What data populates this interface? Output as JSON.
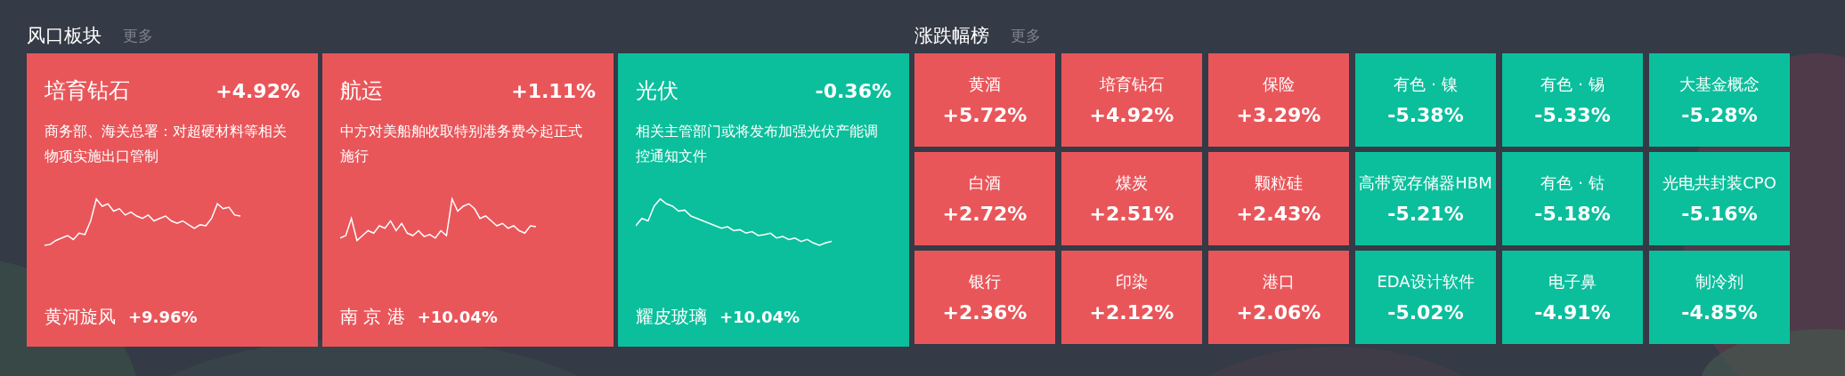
{
  "hot_sectors": {
    "title": "风口板块",
    "more": "更多",
    "cards": [
      {
        "name": "培育钻石",
        "change": "+4.92%",
        "color": "#e9565a",
        "news": "商务部、海关总署：对超硬材料等相关物项实施出口管制",
        "lead_stock": "黄河旋风",
        "lead_change": "+9.96%"
      },
      {
        "name": "航运",
        "change": "+1.11%",
        "color": "#e9565a",
        "news": "中方对美船舶收取特别港务费今起正式施行",
        "lead_stock": "南 京 港",
        "lead_change": "+10.04%"
      },
      {
        "name": "光伏",
        "change": "-0.36%",
        "color": "#0bbf9c",
        "news": "相关主管部门或将发布加强光伏产能调控通知文件",
        "lead_stock": "耀皮玻璃",
        "lead_change": "+10.04%"
      }
    ]
  },
  "ranking": {
    "title": "涨跌幅榜",
    "more": "更多",
    "tiles": [
      {
        "name": "黄酒",
        "change": "+5.72%",
        "color": "#e9565a"
      },
      {
        "name": "培育钻石",
        "change": "+4.92%",
        "color": "#e9565a"
      },
      {
        "name": "保险",
        "change": "+3.29%",
        "color": "#e9565a"
      },
      {
        "name": "有色 · 镍",
        "change": "-5.38%",
        "color": "#0bbf9c"
      },
      {
        "name": "有色 · 锡",
        "change": "-5.33%",
        "color": "#0bbf9c"
      },
      {
        "name": "大基金概念",
        "change": "-5.28%",
        "color": "#0bbf9c"
      },
      {
        "name": "白酒",
        "change": "+2.72%",
        "color": "#e9565a"
      },
      {
        "name": "煤炭",
        "change": "+2.51%",
        "color": "#e9565a"
      },
      {
        "name": "颗粒硅",
        "change": "+2.43%",
        "color": "#e9565a"
      },
      {
        "name": "高带宽存储器HBM",
        "change": "-5.21%",
        "color": "#0bbf9c"
      },
      {
        "name": "有色 · 钴",
        "change": "-5.18%",
        "color": "#0bbf9c"
      },
      {
        "name": "光电共封装CPO",
        "change": "-5.16%",
        "color": "#0bbf9c"
      },
      {
        "name": "银行",
        "change": "+2.36%",
        "color": "#e9565a"
      },
      {
        "name": "印染",
        "change": "+2.12%",
        "color": "#e9565a"
      },
      {
        "name": "港口",
        "change": "+2.06%",
        "color": "#e9565a"
      },
      {
        "name": "EDA设计软件",
        "change": "-5.02%",
        "color": "#0bbf9c"
      },
      {
        "name": "电子鼻",
        "change": "-4.91%",
        "color": "#0bbf9c"
      },
      {
        "name": "制冷剂",
        "change": "-4.85%",
        "color": "#0bbf9c"
      }
    ]
  }
}
